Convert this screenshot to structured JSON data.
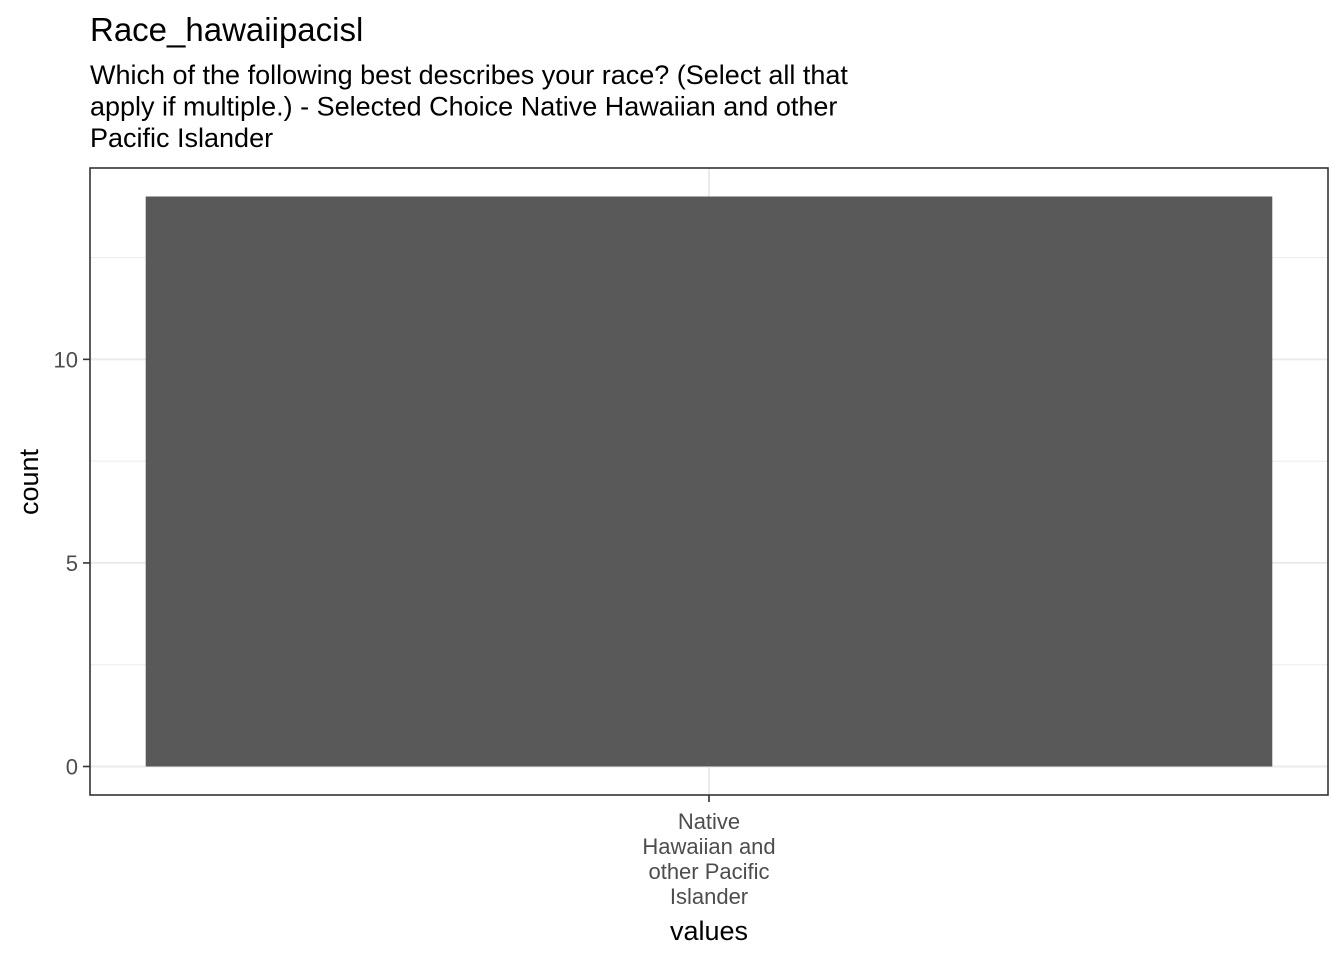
{
  "chart_data": {
    "type": "bar",
    "title": "Race_hawaiipacisl",
    "subtitle_lines": [
      "Which of the following best describes your race? (Select all that",
      "apply if multiple.) - Selected Choice Native Hawaiian and other",
      "Pacific Islander"
    ],
    "xlabel": "values",
    "ylabel": "count",
    "categories": [
      "Native Hawaiian and other Pacific Islander"
    ],
    "category_label_lines": [
      [
        "Native",
        "Hawaiian and",
        "other Pacific",
        "Islander"
      ]
    ],
    "values": [
      14
    ],
    "ylim": [
      -0.7,
      14.7
    ],
    "yticks": [
      0,
      5,
      10
    ],
    "grid": true,
    "bar_color": "#595959",
    "grid_color": "#ebebeb",
    "panel_border_color": "#333333"
  }
}
